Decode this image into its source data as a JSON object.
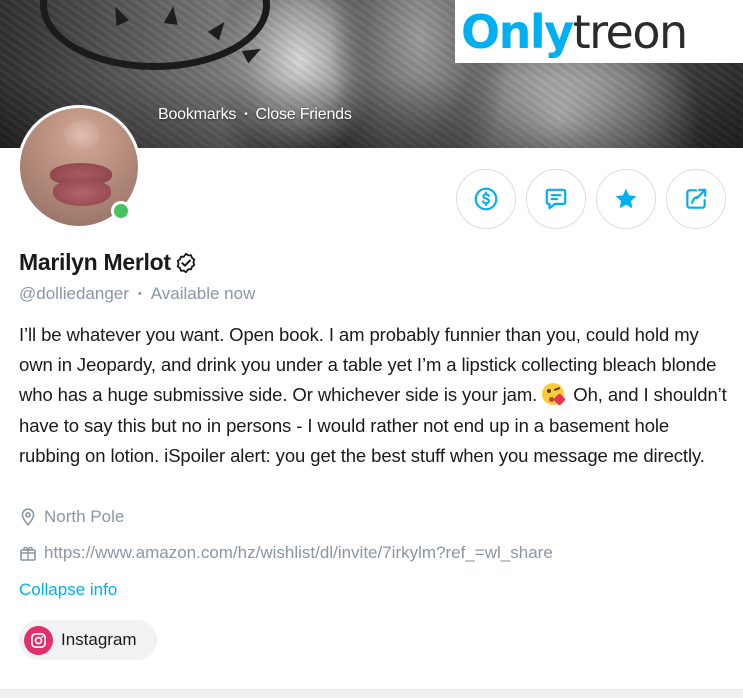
{
  "brand": {
    "part1": "Only",
    "part2": "treon",
    "color": "#00aff0"
  },
  "cover": {
    "links": [
      "Bookmarks",
      "Close Friends"
    ]
  },
  "profile": {
    "name": "Marilyn Merlot",
    "username": "@dolliedanger",
    "status": "Available now",
    "online": true,
    "online_color": "#46c35e",
    "bio_part1": "I’ll be whatever you want. Open book. I am probably funnier than you, could hold my own in Jeopardy, and drink you under a table yet I’m a lipstick collecting bleach blonde who has a huge submissive side. Or whichever side is your jam.",
    "bio_emoji": "face-blowing-a-kiss",
    "bio_part2": " Oh, and I shouldn’t have to say this but no in persons - I would rather not end up in a basement hole rubbing on lotion. iSpoiler alert: you get the best stuff when you message me directly.",
    "location": "North Pole",
    "wishlist_url": "https://www.amazon.com/hz/wishlist/dl/invite/7irkylm?ref_=wl_share",
    "collapse_label": "Collapse info"
  },
  "actions": [
    {
      "icon": "dollar-circle-icon"
    },
    {
      "icon": "message-icon"
    },
    {
      "icon": "star-icon"
    },
    {
      "icon": "share-icon"
    }
  ],
  "social": {
    "label": "Instagram",
    "icon": "instagram-icon",
    "color": "#e1306c"
  },
  "colors": {
    "accent": "#00aff0",
    "muted": "#8a96a3",
    "text": "#1a1a1a"
  }
}
